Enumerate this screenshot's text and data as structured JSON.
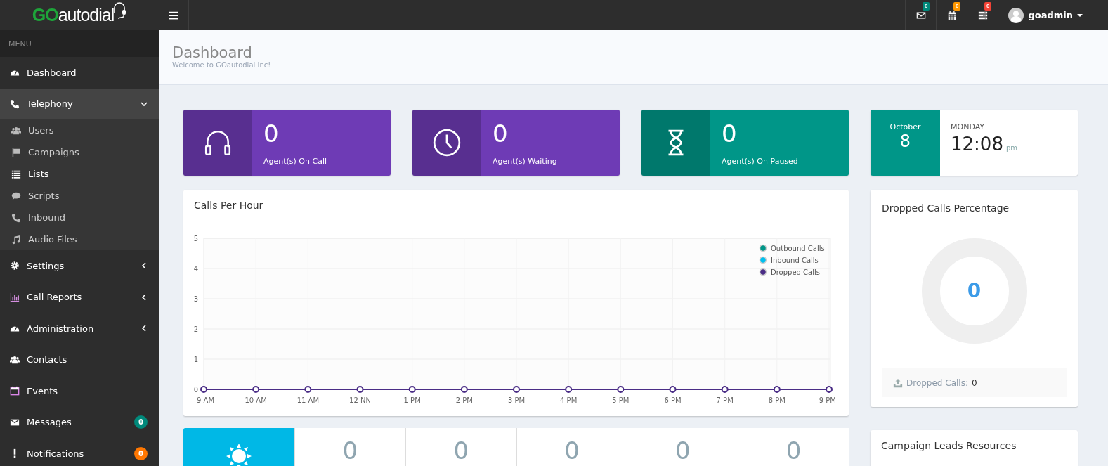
{
  "header": {
    "logo": {
      "prefix": "GO",
      "name": "autodial"
    },
    "notifications": [
      {
        "count": "0",
        "color": "#00897b"
      },
      {
        "count": "0",
        "color": "#ff9800"
      },
      {
        "count": "0",
        "color": "#f44336"
      }
    ],
    "user": {
      "name": "goadmin"
    }
  },
  "sidebar": {
    "heading": "MENU",
    "items": [
      {
        "label": "Dashboard"
      },
      {
        "label": "Telephony",
        "expanded": true,
        "children": [
          {
            "label": "Users",
            "selected": false
          },
          {
            "label": "Campaigns",
            "selected": false
          },
          {
            "label": "Lists",
            "selected": true
          },
          {
            "label": "Scripts",
            "selected": false
          },
          {
            "label": "Inbound",
            "selected": false
          },
          {
            "label": "Audio Files",
            "selected": false
          }
        ]
      },
      {
        "label": "Settings",
        "expanded": false
      },
      {
        "label": "Call Reports",
        "expanded": false
      },
      {
        "label": "Administration",
        "expanded": false
      },
      {
        "label": "Contacts"
      },
      {
        "label": "Events"
      },
      {
        "label": "Messages",
        "badge": "0",
        "color": "#00897b"
      },
      {
        "label": "Notifications",
        "badge": "0",
        "color": "#ff7701"
      }
    ]
  },
  "page": {
    "title": "Dashboard",
    "subtitle": "Welcome to GOautodial Inc!"
  },
  "stats": [
    {
      "value": "0",
      "label": "Agent(s) On Call",
      "color": "#6e3bb5"
    },
    {
      "value": "0",
      "label": "Agent(s) Waiting",
      "color": "#6e3bb5"
    },
    {
      "value": "0",
      "label": "Agent(s) On Paused",
      "color": "#009688"
    }
  ],
  "date": {
    "month": "October",
    "day": "8",
    "weekday": "MONDAY",
    "time": "12:08",
    "period": "pm"
  },
  "calls_chart": {
    "title": "Calls Per Hour",
    "chart_data": {
      "type": "line",
      "categories": [
        "9 AM",
        "10 AM",
        "11 AM",
        "12 NN",
        "1 PM",
        "2 PM",
        "3 PM",
        "4 PM",
        "5 PM",
        "6 PM",
        "7 PM",
        "8 PM",
        "9 PM"
      ],
      "ylim": [
        0,
        5
      ],
      "yticks": [
        0,
        1,
        2,
        3,
        4,
        5
      ],
      "grid": true,
      "legend": true,
      "series": [
        {
          "name": "Outbound Calls",
          "color": "#009688",
          "marker": "circle",
          "values": [
            null,
            null,
            null,
            null,
            null,
            null,
            null,
            null,
            null,
            null,
            null,
            null,
            null
          ]
        },
        {
          "name": "Inbound Calls",
          "color": "#00c0ef",
          "marker": "circle",
          "values": [
            null,
            null,
            null,
            null,
            null,
            null,
            null,
            null,
            null,
            null,
            null,
            null,
            null
          ]
        },
        {
          "name": "Dropped Calls",
          "color": "#4a2d86",
          "marker": "circle",
          "values": [
            0,
            0,
            0,
            0,
            0,
            0,
            0,
            0,
            0,
            0,
            0,
            0,
            0
          ]
        }
      ]
    }
  },
  "dropped": {
    "title": "Dropped Calls Percentage",
    "value": "0",
    "footer_label": "Dropped Calls:",
    "footer_value": "0"
  },
  "summary": {
    "values": [
      "0",
      "0",
      "0",
      "0",
      "0"
    ]
  },
  "campaign_resources": {
    "title": "Campaign Leads Resources"
  }
}
